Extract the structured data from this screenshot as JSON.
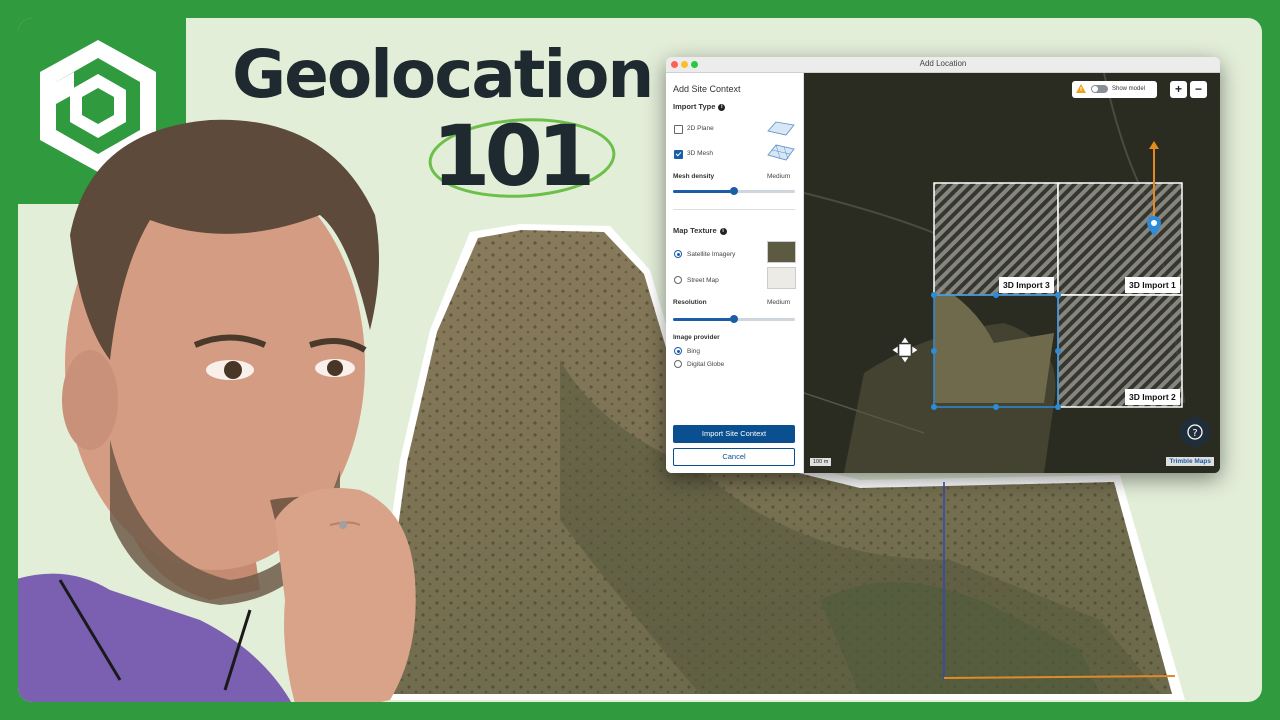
{
  "thumbnail": {
    "title": "Geolocation",
    "subtitle": "101",
    "colors": {
      "brand_green": "#2f9a3e",
      "background": "#e3eed9",
      "text": "#1f2a30",
      "ring": "#6cc04a"
    },
    "logo_icon": "sketchup-logo"
  },
  "window": {
    "title": "Add Location",
    "panel": {
      "header": "Add Site Context",
      "import_type": {
        "label": "Import Type",
        "options": [
          {
            "label": "2D Plane",
            "checked": false
          },
          {
            "label": "3D Mesh",
            "checked": true
          }
        ]
      },
      "mesh_density": {
        "label": "Mesh density",
        "value": "Medium",
        "level": 0.5
      },
      "map_texture": {
        "label": "Map Texture",
        "options": [
          {
            "label": "Satellite Imagery",
            "selected": true
          },
          {
            "label": "Street Map",
            "selected": false
          }
        ]
      },
      "resolution": {
        "label": "Resolution",
        "value": "Medium",
        "level": 0.5
      },
      "image_provider": {
        "label": "Image provider",
        "options": [
          {
            "label": "Bing",
            "selected": true
          },
          {
            "label": "Digital Globe",
            "selected": false
          }
        ]
      },
      "primary_button": "Import Site Context",
      "secondary_button": "Cancel"
    },
    "map": {
      "show_model_label": "Show model",
      "zoom_in": "+",
      "zoom_out": "−",
      "tiles": [
        "3D Import 3",
        "3D Import 1",
        "3D Import 2"
      ],
      "scale": "100 m",
      "attribution": "Trimble Maps"
    }
  }
}
